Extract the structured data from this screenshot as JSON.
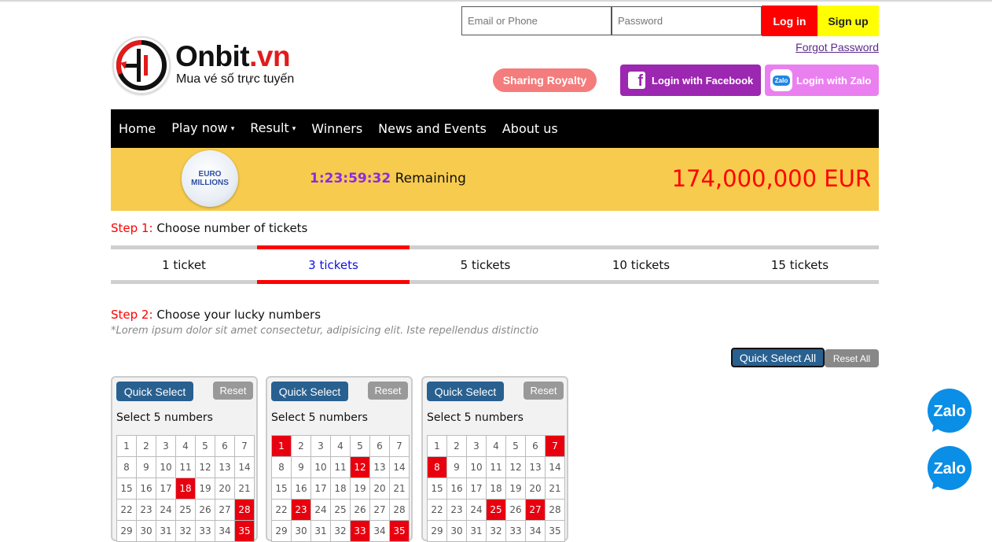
{
  "header": {
    "login": {
      "email_placeholder": "Email or Phone",
      "password_placeholder": "Password",
      "login_label": "Log in",
      "signup_label": "Sign up",
      "forgot_label": "Forgot Password"
    },
    "logo": {
      "name_main": "Onbit",
      "name_suffix": ".vn",
      "tagline": "Mua vé số trực tuyến"
    },
    "sharing_label": "Sharing Royalty",
    "facebook_label": "Login with Facebook",
    "zalo_label": "Login with Zalo",
    "zalo_icon_text": "Zalo"
  },
  "nav": {
    "items": [
      {
        "label": "Home",
        "dropdown": false
      },
      {
        "label": "Play now",
        "dropdown": true
      },
      {
        "label": "Result",
        "dropdown": true
      },
      {
        "label": "Winners",
        "dropdown": false
      },
      {
        "label": "News and Events",
        "dropdown": false
      },
      {
        "label": "About us",
        "dropdown": false
      }
    ],
    "caret": "▾"
  },
  "banner": {
    "game_logo_line1": "EURO",
    "game_logo_line2": "MILLIONS",
    "countdown_time": "1:23:59:32",
    "countdown_suffix": "Remaining",
    "jackpot": "174,000,000 EUR",
    "background_color": "#f7cb4d"
  },
  "step1": {
    "label": "Step 1:",
    "text": "Choose number of tickets"
  },
  "ticket_tabs": {
    "items": [
      "1 ticket",
      "3 tickets",
      "5 tickets",
      "10 tickets",
      "15 tickets"
    ],
    "active_index": 1
  },
  "step2": {
    "label": "Step 2:",
    "text": "Choose your lucky numbers",
    "note": "*Lorem ipsum dolor sit amet consectetur, adipisicing elit. Iste repellendus distinctio"
  },
  "actions": {
    "quick_select_all": "Quick Select All",
    "reset_all": "Reset All"
  },
  "tickets": [
    {
      "quick_select": "Quick Select",
      "reset": "Reset",
      "instruction": "Select 5 numbers",
      "selected": [
        18,
        28,
        35
      ]
    },
    {
      "quick_select": "Quick Select",
      "reset": "Reset",
      "instruction": "Select 5 numbers",
      "selected": [
        1,
        12,
        23,
        33,
        35
      ]
    },
    {
      "quick_select": "Quick Select",
      "reset": "Reset",
      "instruction": "Select 5 numbers",
      "selected": [
        7,
        8,
        25,
        27
      ]
    }
  ],
  "grid_numbers": [
    1,
    2,
    3,
    4,
    5,
    6,
    7,
    8,
    9,
    10,
    11,
    12,
    13,
    14,
    15,
    16,
    17,
    18,
    19,
    20,
    21,
    22,
    23,
    24,
    25,
    26,
    27,
    28,
    29,
    30,
    31,
    32,
    33,
    34,
    35
  ],
  "floating": {
    "zalo_label": "Zalo"
  },
  "colors": {
    "accent_red": "#ff0000",
    "brand_purple": "#9c27b0",
    "zalo_pink": "#ea80f0",
    "button_blue": "#286090",
    "selected_number": "#e8000f"
  }
}
